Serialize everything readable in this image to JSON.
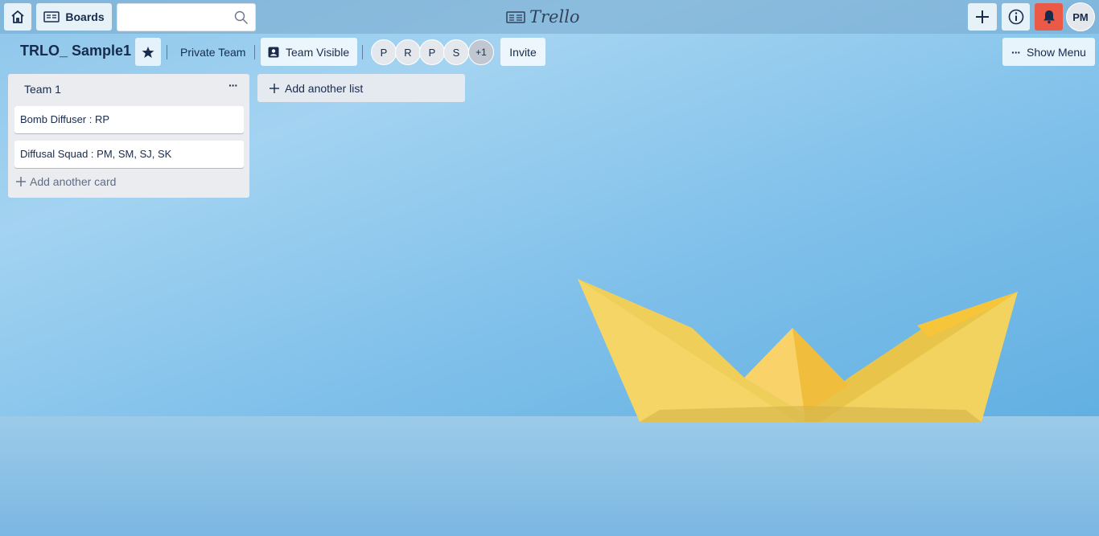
{
  "header": {
    "boards_label": "Boards",
    "search_placeholder": "",
    "logo_text": "Trello",
    "user_initials": "PM"
  },
  "board": {
    "title": "TRLO_ Sample1",
    "team_name": "Private Team",
    "visibility_label": "Team Visible",
    "members": [
      "P",
      "R",
      "P",
      "S"
    ],
    "more_members": "+1",
    "invite_label": "Invite",
    "show_menu_label": "Show Menu"
  },
  "lists": [
    {
      "title": "Team 1",
      "menu": "···",
      "cards": [
        "Bomb Diffuser : RP",
        "Diffusal Squad : PM, SM, SJ, SK"
      ],
      "add_card_label": "Add another card"
    }
  ],
  "add_list_label": "Add another list",
  "colors": {
    "notification_accent": "#eb5a46",
    "text": "#172b4d",
    "list_bg": "#ebecf0"
  }
}
